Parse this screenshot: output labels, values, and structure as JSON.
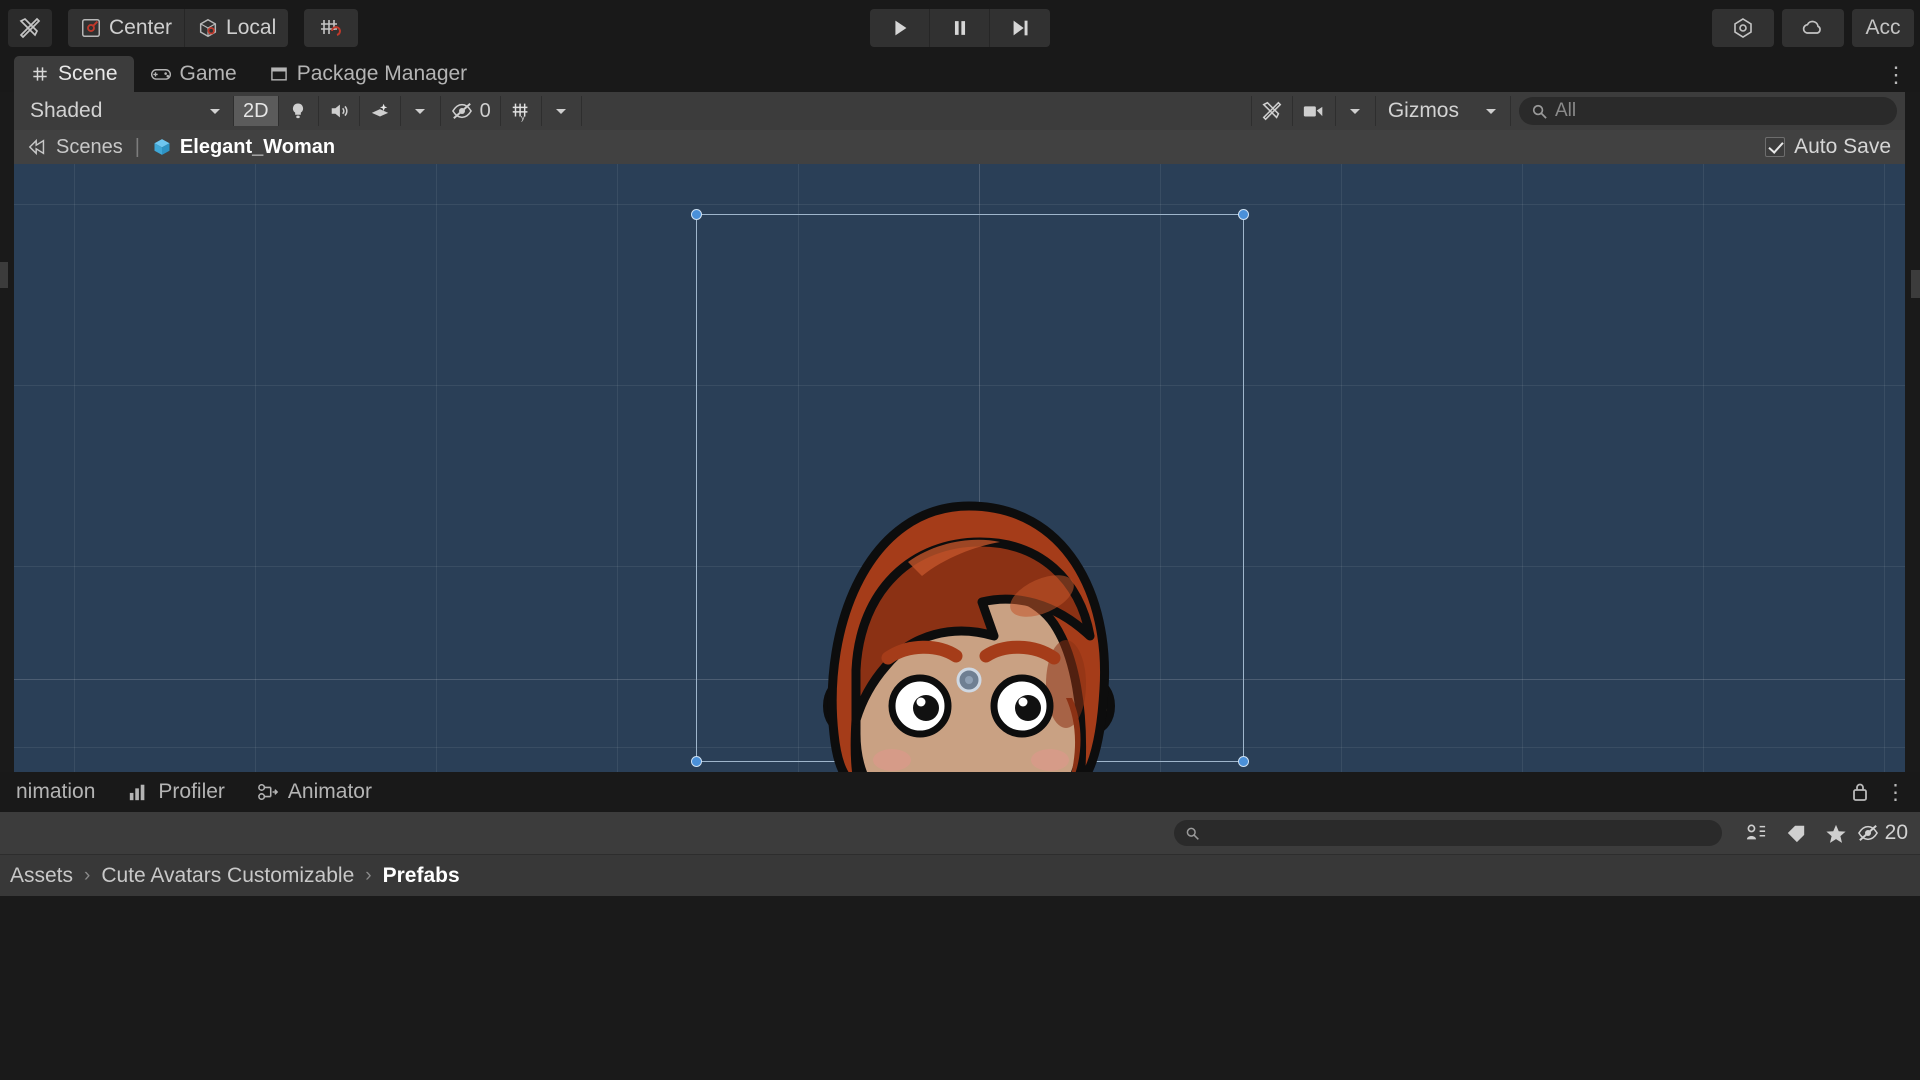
{
  "toolbar": {
    "tools_icon": "tools-icon",
    "pivot_mode": "Center",
    "pivot_rotation": "Local",
    "grid_snap_icon": "grid-snap-icon",
    "play": "play-icon",
    "pause": "pause-icon",
    "step": "step-icon",
    "cloud": "cloud-icon",
    "collab": "collab-icon",
    "account_label": "Acc"
  },
  "tabs": [
    {
      "label": "Scene",
      "icon": "scene-grid-icon",
      "active": true
    },
    {
      "label": "Game",
      "icon": "gamepad-icon",
      "active": false
    },
    {
      "label": "Package Manager",
      "icon": "package-icon",
      "active": false
    }
  ],
  "tab_overflow": "⋮",
  "scene_toolbar": {
    "draw_mode": "Shaded",
    "mode_2d": "2D",
    "lighting_icon": "lightbulb-icon",
    "audio_icon": "audio-icon",
    "effects_icon": "effects-icon",
    "effects_dropdown": "chevron-down-icon",
    "hidden_icon": "eye-off-icon",
    "hidden_count": "0",
    "grid_icon": "grid-axis-icon",
    "grid_dropdown": "chevron-down-icon",
    "tools_icon": "tools-icon",
    "camera_icon": "camera-icon",
    "camera_dropdown": "chevron-down-icon",
    "gizmos_label": "Gizmos",
    "gizmos_dropdown": "chevron-down-icon",
    "search_placeholder": "All"
  },
  "breadcrumb": {
    "root": "Scenes",
    "separator": "|",
    "current": "Elegant_Woman",
    "prefab_icon": "prefab-cube-icon",
    "scenes_icon": "scene-back-icon",
    "auto_save_label": "Auto Save",
    "auto_save_checked": true
  },
  "viewport": {
    "background_color": "#2a3f57",
    "grid_color": "#ffffff",
    "selection_color": "#9fb6cc",
    "handle_color": "#4a90d9",
    "avatar": {
      "name": "Elegant_Woman",
      "hair_color": "#a53c19",
      "hair_shadow": "#8b3114",
      "hair_highlight": "#b8491f",
      "skin_color": "#c9a183",
      "skin_shadow": "#b8906f",
      "blush_color": "#d99a8a",
      "shirt_color": "#e8e8e8",
      "shirt_shadow": "#d2d2d2",
      "outline_color": "#0d0d0d",
      "eye_white": "#ffffff",
      "eye_pupil": "#111111"
    }
  },
  "bottom_tabs": [
    {
      "label": "nimation",
      "icon": "animation-icon"
    },
    {
      "label": "Profiler",
      "icon": "profiler-icon"
    },
    {
      "label": "Animator",
      "icon": "animator-icon"
    }
  ],
  "bottom_tabs_right": {
    "lock_icon": "lock-icon",
    "menu_icon": "kebab-menu-icon"
  },
  "project_bar": {
    "search_placeholder": "",
    "search_icon": "search-icon",
    "filter_type_icon": "filter-type-icon",
    "filter_label_icon": "filter-label-icon",
    "favorite_icon": "star-icon",
    "visibility_icon": "eye-off-icon",
    "visibility_count": "20"
  },
  "path_bar": {
    "segments": [
      "Assets",
      "Cute Avatars Customizable",
      "Prefabs"
    ],
    "arrow": "›"
  }
}
